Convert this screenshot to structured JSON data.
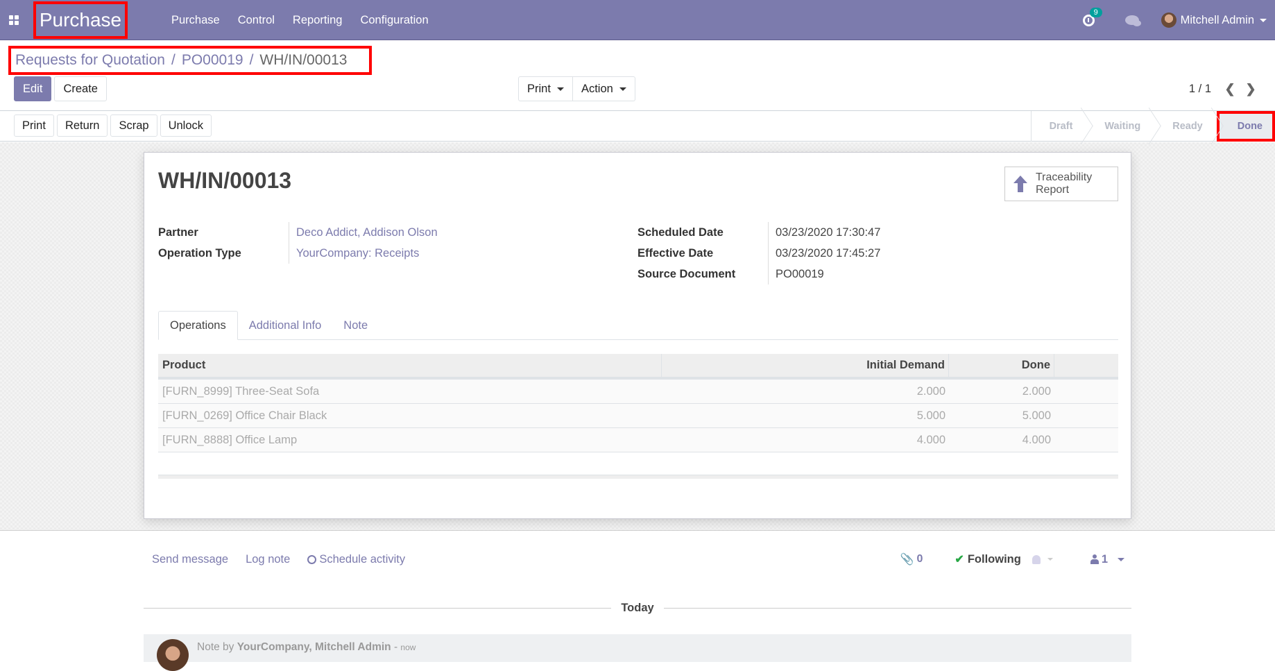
{
  "navbar": {
    "app_name": "Purchase",
    "menu": [
      "Purchase",
      "Control",
      "Reporting",
      "Configuration"
    ],
    "activity_count": "9",
    "user_name": "Mitchell Admin"
  },
  "breadcrumb": {
    "items": [
      "Requests for Quotation",
      "PO00019"
    ],
    "current": "WH/IN/00013",
    "separator": "/"
  },
  "control_panel": {
    "edit_label": "Edit",
    "create_label": "Create",
    "print_label": "Print",
    "action_label": "Action",
    "pager": "1 / 1"
  },
  "statusbar": {
    "buttons": [
      "Print",
      "Return",
      "Scrap",
      "Unlock"
    ],
    "stages": [
      "Draft",
      "Waiting",
      "Ready",
      "Done"
    ],
    "current_stage": "Done"
  },
  "form": {
    "title": "WH/IN/00013",
    "traceability_label_1": "Traceability",
    "traceability_label_2": "Report",
    "left_fields": [
      {
        "label": "Partner",
        "value": "Deco Addict, Addison Olson"
      },
      {
        "label": "Operation Type",
        "value": "YourCompany: Receipts"
      }
    ],
    "right_fields": [
      {
        "label": "Scheduled Date",
        "value": "03/23/2020 17:30:47"
      },
      {
        "label": "Effective Date",
        "value": "03/23/2020 17:45:27"
      },
      {
        "label": "Source Document",
        "value": "PO00019"
      }
    ],
    "tabs": [
      "Operations",
      "Additional Info",
      "Note"
    ],
    "active_tab": "Operations"
  },
  "operations_table": {
    "columns": [
      "Product",
      "Initial Demand",
      "Done"
    ],
    "rows": [
      {
        "product": "[FURN_8999] Three-Seat Sofa",
        "initial_demand": "2.000",
        "done": "2.000",
        "has_details": false
      },
      {
        "product": "[FURN_0269] Office Chair Black",
        "initial_demand": "5.000",
        "done": "5.000",
        "has_details": true
      },
      {
        "product": "[FURN_8888] Office Lamp",
        "initial_demand": "4.000",
        "done": "4.000",
        "has_details": true
      }
    ]
  },
  "chatter": {
    "send_message": "Send message",
    "log_note": "Log note",
    "schedule_activity": "Schedule activity",
    "attachments_count": "0",
    "following_label": "Following",
    "followers_count": "1",
    "date_separator": "Today",
    "message": {
      "type_prefix": "Note by",
      "author": "YourCompany, Mitchell Admin",
      "dash": "-",
      "time": "now"
    }
  },
  "colors": {
    "brand": "#7c7bad",
    "highlight": "#ff0000",
    "badge": "#00a09d",
    "following_check": "#28a745"
  }
}
